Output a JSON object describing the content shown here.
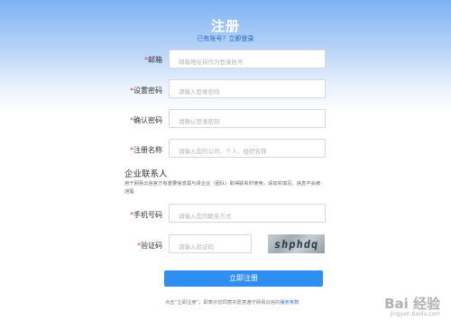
{
  "header": {
    "title": "注册",
    "have_account_text": "已有账号？",
    "login_link": "立即登录"
  },
  "fields": [
    {
      "label_star": "*",
      "label": "邮箱",
      "placeholder": "邮箱地址将作为登录账号",
      "value": ""
    },
    {
      "label_star": "*",
      "label": "设置密码",
      "placeholder": "请输入登录密码",
      "value": ""
    },
    {
      "label_star": "*",
      "label": "确认密码",
      "placeholder": "请确认登录密码",
      "value": ""
    },
    {
      "label_star": "*",
      "label": "注册名称",
      "placeholder": "请输入您的公司、个人、组织名称",
      "value": ""
    }
  ],
  "contact_section": {
    "title": "企业联系人",
    "note": "用于网易云信官方有重要信息需与贵企业（团队）取得联系时使用，请如实填写，信息不会被泄露",
    "phone": {
      "label_star": "*",
      "label": "手机号码",
      "placeholder": "请输入您的联系方式",
      "value": ""
    },
    "captcha": {
      "label_star": "*",
      "label": "验证码",
      "placeholder": "请输入验证码",
      "value": "",
      "image_text": "shphdq"
    }
  },
  "submit_label": "立即注册",
  "agreement": {
    "prefix": "点击“立即注册”，即表示您同意并愿意遵守网易云信的",
    "link": "服务条款"
  },
  "watermark": {
    "brand": "Bai 经验",
    "url": "jingyan.baidu.com"
  },
  "colors": {
    "header_gradient_top": "#7fb2f4",
    "accent": "#2f8ff0",
    "required_star": "#e03b3b"
  }
}
